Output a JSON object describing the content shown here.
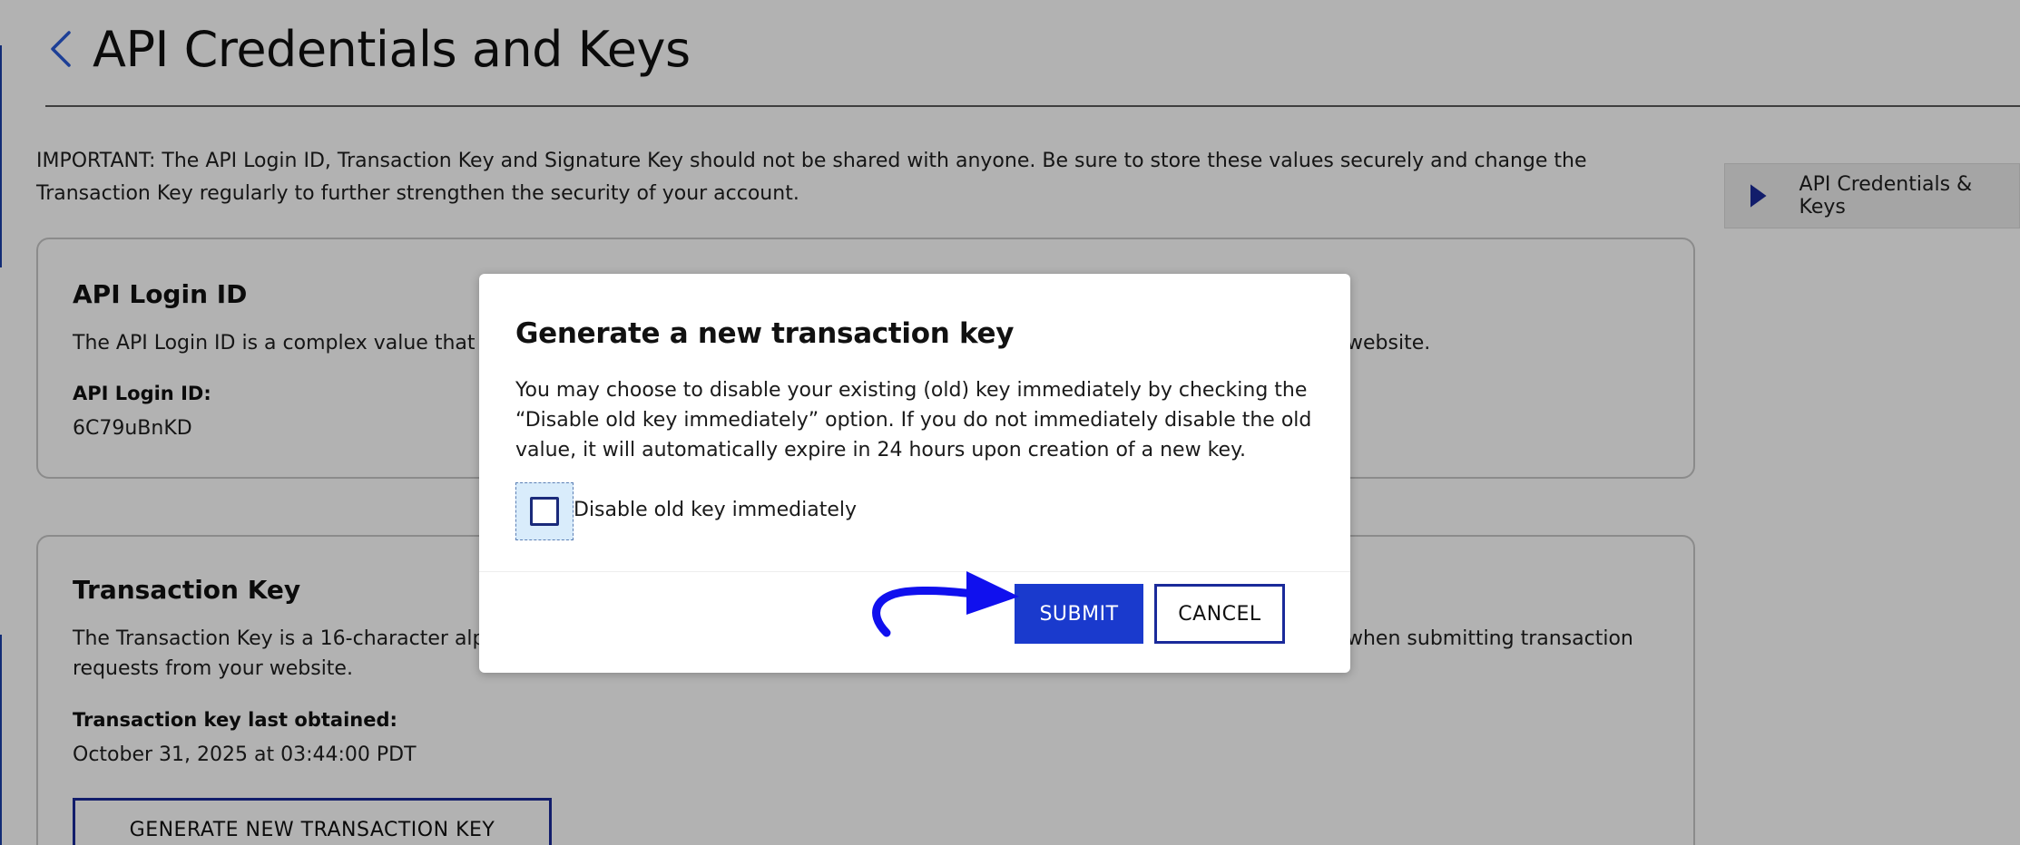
{
  "header": {
    "title": "API Credentials and Keys"
  },
  "notice": "IMPORTANT: The API Login ID, Transaction Key and Signature Key should not be shared with anyone. Be sure to store these values securely and change the Transaction Key regularly to further strengthen the security of your account.",
  "side_nav": {
    "item_label": "API Credentials & Keys"
  },
  "login_card": {
    "heading": "API Login ID",
    "description_left": "The API Login ID is a complex value that iden",
    "description_right": "website.",
    "field_label": "API Login ID:",
    "field_value": "6C79uBnKD"
  },
  "txn_card": {
    "heading": "Transaction Key",
    "description_line1_left": "The Transaction Key is a 16-character alphan",
    "description_line1_right": "when submitting transaction",
    "description_line2": "requests from your website.",
    "field_label": "Transaction key last obtained:",
    "field_value": "October 31, 2025 at 03:44:00 PDT",
    "generate_button": "GENERATE NEW TRANSACTION KEY"
  },
  "modal": {
    "title": "Generate a new transaction key",
    "body": "You may choose to disable your existing (old) key immediately by checking the “Disable old key immediately” option. If you do not immediately disable the old value, it will automatically expire in 24 hours upon creation of a new key.",
    "checkbox_label": "Disable old key immediately",
    "checkbox_checked": false,
    "submit_label": "SUBMIT",
    "cancel_label": "CANCEL"
  },
  "colors": {
    "primary_button": "#1a3acd",
    "button_border": "#1a2a9a",
    "annotation_arrow": "#1010ee",
    "overlay": "rgba(0,0,0,0.30)"
  },
  "icons": {
    "back": "chevron-left-icon",
    "side_nav": "play-triangle-icon",
    "annotation": "curved-arrow-icon"
  }
}
